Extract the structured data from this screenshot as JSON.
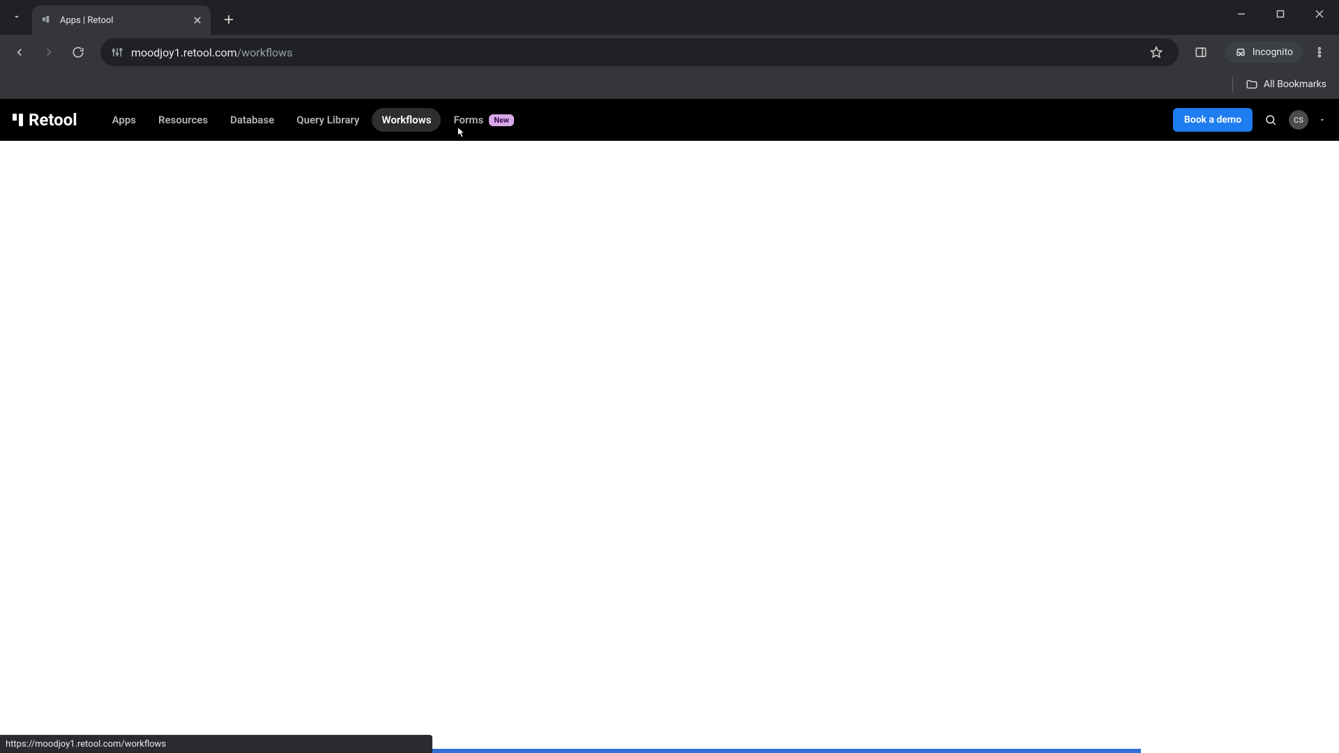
{
  "browser": {
    "tab_title": "Apps | Retool",
    "url_host": "moodjoy1.retool.com",
    "url_path": "/workflows",
    "all_bookmarks_label": "All Bookmarks",
    "incognito_label": "Incognito"
  },
  "header": {
    "brand": "Retool",
    "nav": [
      {
        "label": "Apps"
      },
      {
        "label": "Resources"
      },
      {
        "label": "Database"
      },
      {
        "label": "Query Library"
      },
      {
        "label": "Workflows",
        "active": true
      },
      {
        "label": "Forms",
        "badge": "New"
      }
    ],
    "demo_button": "Book a demo",
    "avatar_initials": "CS"
  },
  "status_url": "https://moodjoy1.retool.com/workflows"
}
